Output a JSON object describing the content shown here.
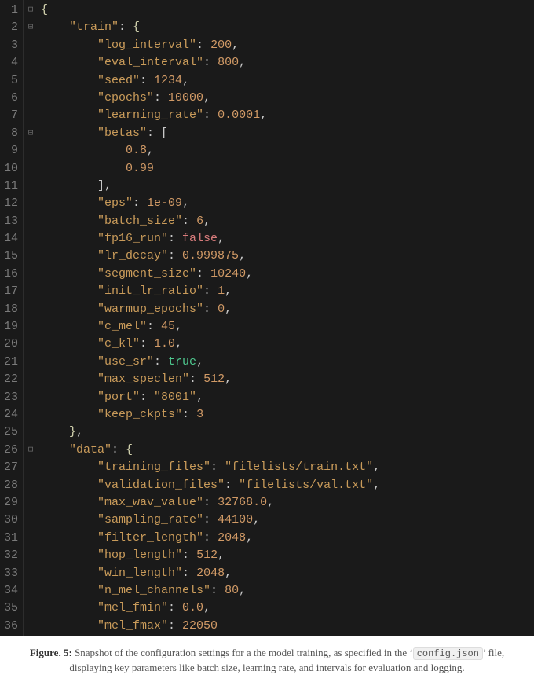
{
  "caption": {
    "label": "Figure. 5:",
    "text_before": " Snapshot of the configuration settings for a the model training, as specified in the ‘",
    "filename_code": "config.json",
    "text_after": "’ file, displaying key parameters like batch size, learning rate, and intervals for evaluation and logging."
  },
  "line_numbers": [
    "1",
    "2",
    "3",
    "4",
    "5",
    "6",
    "7",
    "8",
    "9",
    "10",
    "11",
    "12",
    "13",
    "14",
    "15",
    "16",
    "17",
    "18",
    "19",
    "20",
    "21",
    "22",
    "23",
    "24",
    "25",
    "26",
    "27",
    "28",
    "29",
    "30",
    "31",
    "32",
    "33",
    "34",
    "35",
    "36"
  ],
  "fold_markers": {
    "0": "⊟",
    "1": "⊟",
    "7": "⊟",
    "25": "⊟"
  },
  "code_lines": [
    [
      [
        "brace",
        "{"
      ]
    ],
    [
      [
        "punc",
        "    "
      ],
      [
        "str",
        "\"train\""
      ],
      [
        "punc",
        ": "
      ],
      [
        "brace",
        "{"
      ]
    ],
    [
      [
        "punc",
        "        "
      ],
      [
        "str",
        "\"log_interval\""
      ],
      [
        "punc",
        ": "
      ],
      [
        "num",
        "200"
      ],
      [
        "punc",
        ","
      ]
    ],
    [
      [
        "punc",
        "        "
      ],
      [
        "str",
        "\"eval_interval\""
      ],
      [
        "punc",
        ": "
      ],
      [
        "num",
        "800"
      ],
      [
        "punc",
        ","
      ]
    ],
    [
      [
        "punc",
        "        "
      ],
      [
        "str",
        "\"seed\""
      ],
      [
        "punc",
        ": "
      ],
      [
        "num",
        "1234"
      ],
      [
        "punc",
        ","
      ]
    ],
    [
      [
        "punc",
        "        "
      ],
      [
        "str",
        "\"epochs\""
      ],
      [
        "punc",
        ": "
      ],
      [
        "num",
        "10000"
      ],
      [
        "punc",
        ","
      ]
    ],
    [
      [
        "punc",
        "        "
      ],
      [
        "str",
        "\"learning_rate\""
      ],
      [
        "punc",
        ": "
      ],
      [
        "num",
        "0.0001"
      ],
      [
        "punc",
        ","
      ]
    ],
    [
      [
        "punc",
        "        "
      ],
      [
        "str",
        "\"betas\""
      ],
      [
        "punc",
        ": "
      ],
      [
        "punc",
        "["
      ]
    ],
    [
      [
        "punc",
        "            "
      ],
      [
        "num",
        "0.8"
      ],
      [
        "punc",
        ","
      ]
    ],
    [
      [
        "punc",
        "            "
      ],
      [
        "num",
        "0.99"
      ]
    ],
    [
      [
        "punc",
        "        "
      ],
      [
        "punc",
        "]"
      ],
      [
        "punc",
        ","
      ]
    ],
    [
      [
        "punc",
        "        "
      ],
      [
        "str",
        "\"eps\""
      ],
      [
        "punc",
        ": "
      ],
      [
        "num",
        "1e-09"
      ],
      [
        "punc",
        ","
      ]
    ],
    [
      [
        "punc",
        "        "
      ],
      [
        "str",
        "\"batch_size\""
      ],
      [
        "punc",
        ": "
      ],
      [
        "num",
        "6"
      ],
      [
        "punc",
        ","
      ]
    ],
    [
      [
        "punc",
        "        "
      ],
      [
        "str",
        "\"fp16_run\""
      ],
      [
        "punc",
        ": "
      ],
      [
        "bool-f",
        "false"
      ],
      [
        "punc",
        ","
      ]
    ],
    [
      [
        "punc",
        "        "
      ],
      [
        "str",
        "\"lr_decay\""
      ],
      [
        "punc",
        ": "
      ],
      [
        "num",
        "0.999875"
      ],
      [
        "punc",
        ","
      ]
    ],
    [
      [
        "punc",
        "        "
      ],
      [
        "str",
        "\"segment_size\""
      ],
      [
        "punc",
        ": "
      ],
      [
        "num",
        "10240"
      ],
      [
        "punc",
        ","
      ]
    ],
    [
      [
        "punc",
        "        "
      ],
      [
        "str",
        "\"init_lr_ratio\""
      ],
      [
        "punc",
        ": "
      ],
      [
        "num",
        "1"
      ],
      [
        "punc",
        ","
      ]
    ],
    [
      [
        "punc",
        "        "
      ],
      [
        "str",
        "\"warmup_epochs\""
      ],
      [
        "punc",
        ": "
      ],
      [
        "num",
        "0"
      ],
      [
        "punc",
        ","
      ]
    ],
    [
      [
        "punc",
        "        "
      ],
      [
        "str",
        "\"c_mel\""
      ],
      [
        "punc",
        ": "
      ],
      [
        "num",
        "45"
      ],
      [
        "punc",
        ","
      ]
    ],
    [
      [
        "punc",
        "        "
      ],
      [
        "str",
        "\"c_kl\""
      ],
      [
        "punc",
        ": "
      ],
      [
        "num",
        "1.0"
      ],
      [
        "punc",
        ","
      ]
    ],
    [
      [
        "punc",
        "        "
      ],
      [
        "str",
        "\"use_sr\""
      ],
      [
        "punc",
        ": "
      ],
      [
        "bool-t",
        "true"
      ],
      [
        "punc",
        ","
      ]
    ],
    [
      [
        "punc",
        "        "
      ],
      [
        "str",
        "\"max_speclen\""
      ],
      [
        "punc",
        ": "
      ],
      [
        "num",
        "512"
      ],
      [
        "punc",
        ","
      ]
    ],
    [
      [
        "punc",
        "        "
      ],
      [
        "str",
        "\"port\""
      ],
      [
        "punc",
        ": "
      ],
      [
        "str",
        "\"8001\""
      ],
      [
        "punc",
        ","
      ]
    ],
    [
      [
        "punc",
        "        "
      ],
      [
        "str",
        "\"keep_ckpts\""
      ],
      [
        "punc",
        ": "
      ],
      [
        "num",
        "3"
      ]
    ],
    [
      [
        "punc",
        "    "
      ],
      [
        "brace",
        "}"
      ],
      [
        "punc",
        ","
      ]
    ],
    [
      [
        "punc",
        "    "
      ],
      [
        "str",
        "\"data\""
      ],
      [
        "punc",
        ": "
      ],
      [
        "brace",
        "{"
      ]
    ],
    [
      [
        "punc",
        "        "
      ],
      [
        "str",
        "\"training_files\""
      ],
      [
        "punc",
        ": "
      ],
      [
        "str",
        "\"filelists/train.txt\""
      ],
      [
        "punc",
        ","
      ]
    ],
    [
      [
        "punc",
        "        "
      ],
      [
        "str",
        "\"validation_files\""
      ],
      [
        "punc",
        ": "
      ],
      [
        "str",
        "\"filelists/val.txt\""
      ],
      [
        "punc",
        ","
      ]
    ],
    [
      [
        "punc",
        "        "
      ],
      [
        "str",
        "\"max_wav_value\""
      ],
      [
        "punc",
        ": "
      ],
      [
        "num",
        "32768.0"
      ],
      [
        "punc",
        ","
      ]
    ],
    [
      [
        "punc",
        "        "
      ],
      [
        "str",
        "\"sampling_rate\""
      ],
      [
        "punc",
        ": "
      ],
      [
        "num",
        "44100"
      ],
      [
        "punc",
        ","
      ]
    ],
    [
      [
        "punc",
        "        "
      ],
      [
        "str",
        "\"filter_length\""
      ],
      [
        "punc",
        ": "
      ],
      [
        "num",
        "2048"
      ],
      [
        "punc",
        ","
      ]
    ],
    [
      [
        "punc",
        "        "
      ],
      [
        "str",
        "\"hop_length\""
      ],
      [
        "punc",
        ": "
      ],
      [
        "num",
        "512"
      ],
      [
        "punc",
        ","
      ]
    ],
    [
      [
        "punc",
        "        "
      ],
      [
        "str",
        "\"win_length\""
      ],
      [
        "punc",
        ": "
      ],
      [
        "num",
        "2048"
      ],
      [
        "punc",
        ","
      ]
    ],
    [
      [
        "punc",
        "        "
      ],
      [
        "str",
        "\"n_mel_channels\""
      ],
      [
        "punc",
        ": "
      ],
      [
        "num",
        "80"
      ],
      [
        "punc",
        ","
      ]
    ],
    [
      [
        "punc",
        "        "
      ],
      [
        "str",
        "\"mel_fmin\""
      ],
      [
        "punc",
        ": "
      ],
      [
        "num",
        "0.0"
      ],
      [
        "punc",
        ","
      ]
    ],
    [
      [
        "punc",
        "        "
      ],
      [
        "str",
        "\"mel_fmax\""
      ],
      [
        "punc",
        ": "
      ],
      [
        "num",
        "22050"
      ]
    ]
  ]
}
